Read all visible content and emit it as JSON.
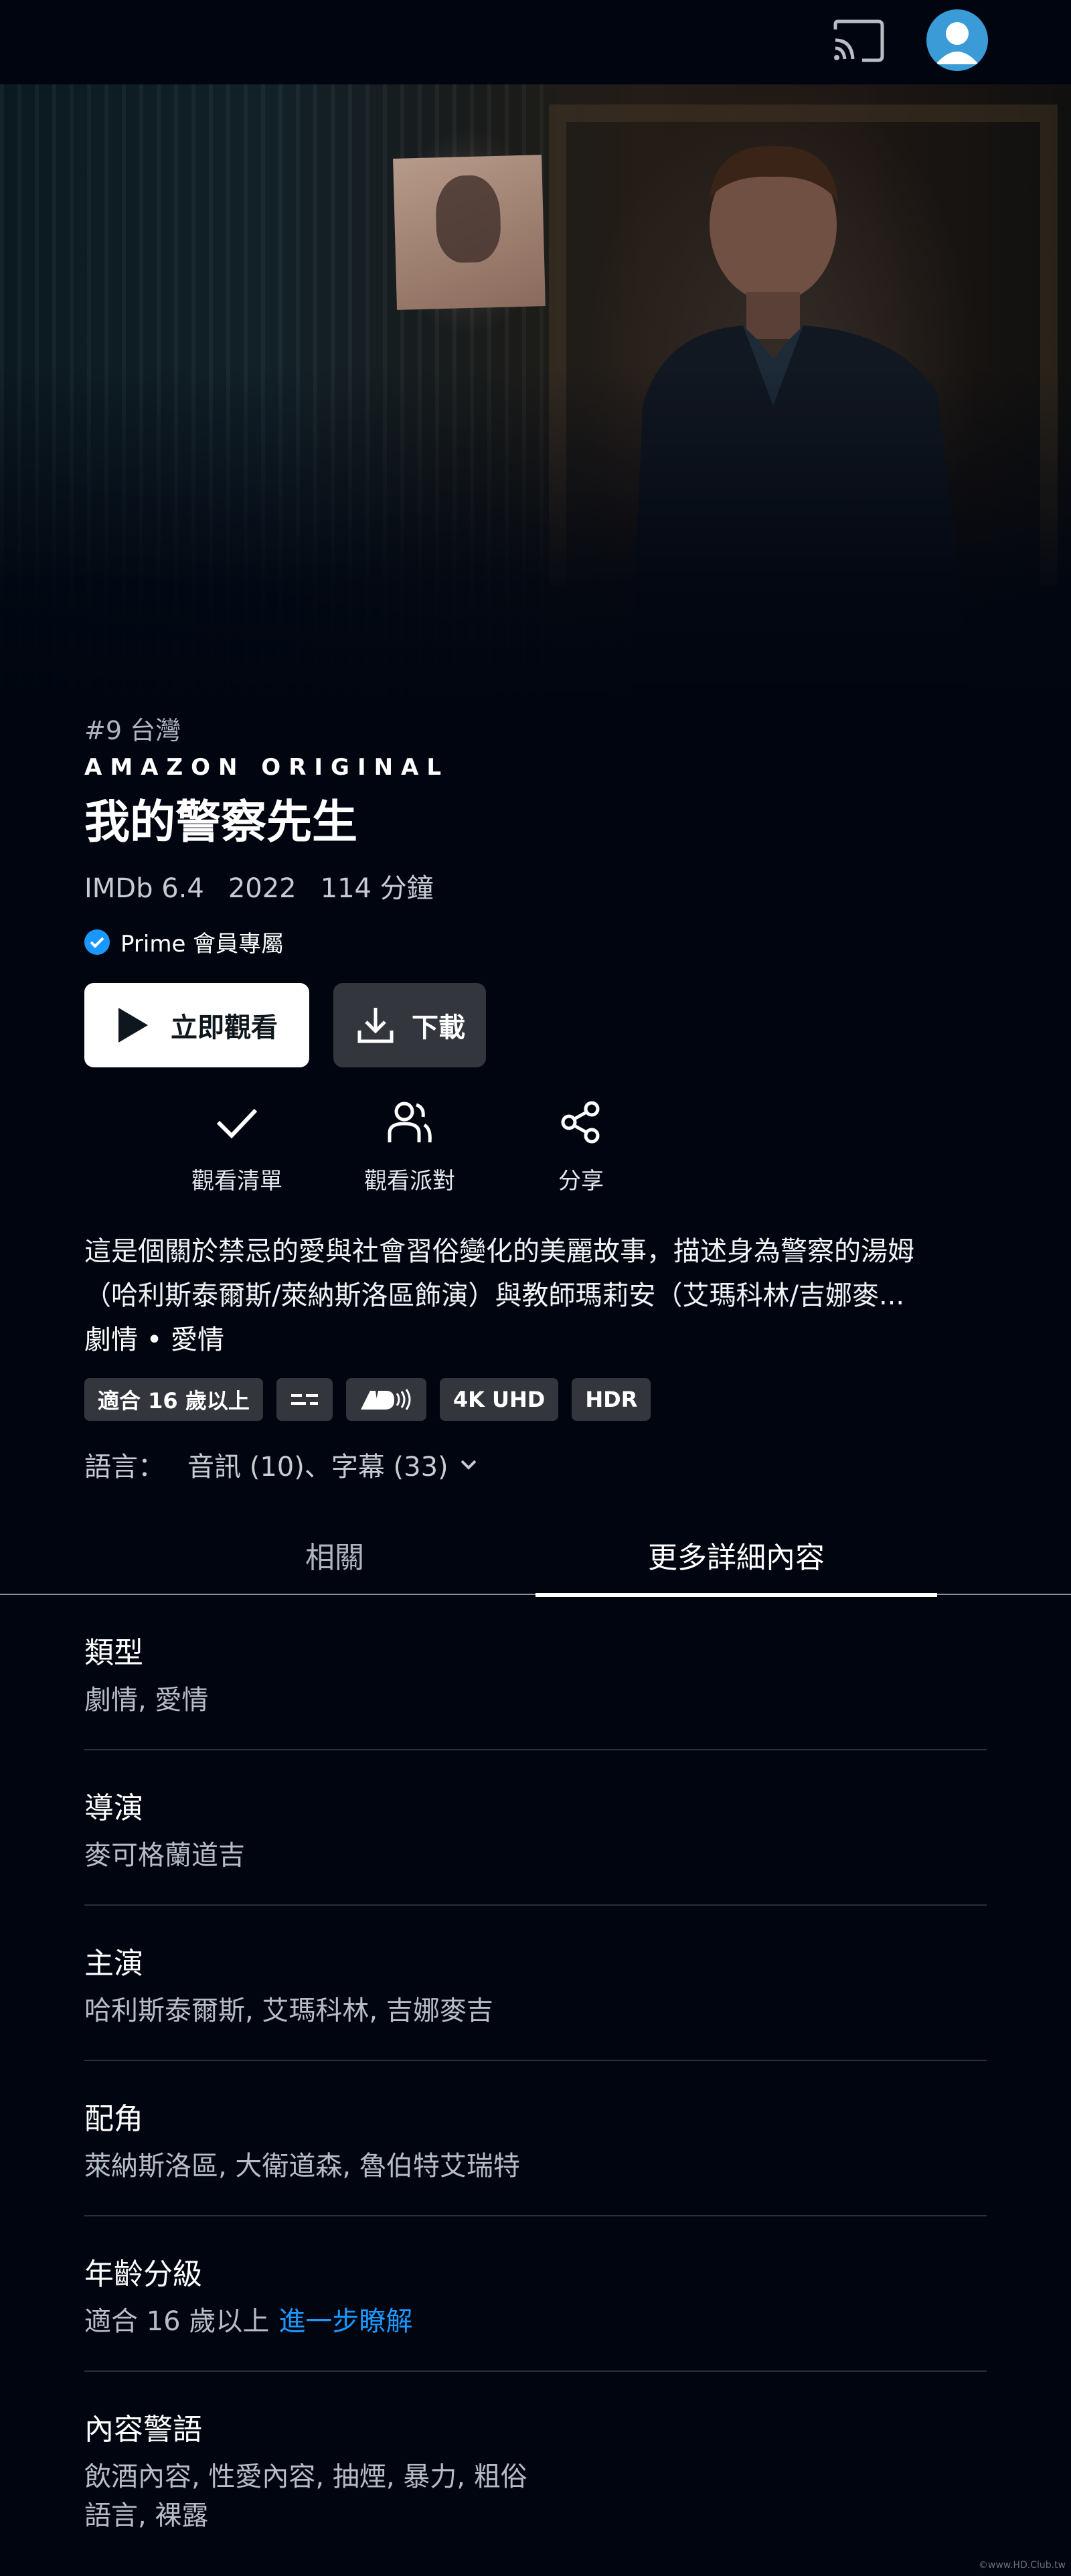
{
  "header": {
    "cast_icon": "cast-icon",
    "avatar_icon": "user-avatar-icon"
  },
  "hero": {
    "image": "movie-still"
  },
  "title_block": {
    "rank": "#9 台灣",
    "original_label": "AMAZON ORIGINAL",
    "title": "我的警察先生",
    "imdb": "IMDb 6.4",
    "year": "2022",
    "runtime": "114 分鐘",
    "prime_badge": "Prime 會員專屬"
  },
  "buttons": {
    "watch_now": "立即觀看",
    "download": "下載"
  },
  "actions": [
    {
      "label": "觀看清單",
      "icon": "check-icon"
    },
    {
      "label": "觀看派對",
      "icon": "watch-party-icon"
    },
    {
      "label": "分享",
      "icon": "share-icon"
    }
  ],
  "synopsis": {
    "line1": "這是個關於禁忌的愛與社會習俗變化的美麗故事，描述身為警察的湯姆",
    "line2": "（哈利斯泰爾斯/萊納斯洛區飾演）與教師瑪莉安（艾瑪科林/吉娜麥..."
  },
  "genres_inline": "劇情 • 愛情",
  "badges": {
    "rating": "適合 16 歲以上",
    "subtitle_icon": "subtitles-icon",
    "ad_icon": "audio-description-icon",
    "uhd": "4K UHD",
    "hdr": "HDR"
  },
  "language": {
    "label": "語言：",
    "value": "音訊 (10)、字幕 (33)",
    "icon": "chevron-down-icon"
  },
  "tabs": [
    {
      "label": "相關",
      "active": false
    },
    {
      "label": "更多詳細內容",
      "active": true
    }
  ],
  "details": {
    "genre": {
      "heading": "類型",
      "value": "劇情, 愛情"
    },
    "director": {
      "heading": "導演",
      "value": "麥可格蘭道吉"
    },
    "starring": {
      "heading": "主演",
      "value": "哈利斯泰爾斯, 艾瑪科林, 吉娜麥吉"
    },
    "supporting": {
      "heading": "配角",
      "value": "萊納斯洛區, 大衛道森, 魯伯特艾瑞特"
    },
    "age_rating": {
      "heading": "年齡分級",
      "value": "適合 16 歲以上",
      "link": "進一步瞭解"
    },
    "content_warning": {
      "heading": "內容警語",
      "line1": "飲酒內容, 性愛內容, 抽煙, 暴力, 粗俗",
      "line2": "語言, 裸露"
    }
  },
  "watermark": "©www.HD.Club.tw",
  "colors": {
    "background": "#000510",
    "accent": "#1a98ff",
    "button_dark": "#33373d"
  }
}
